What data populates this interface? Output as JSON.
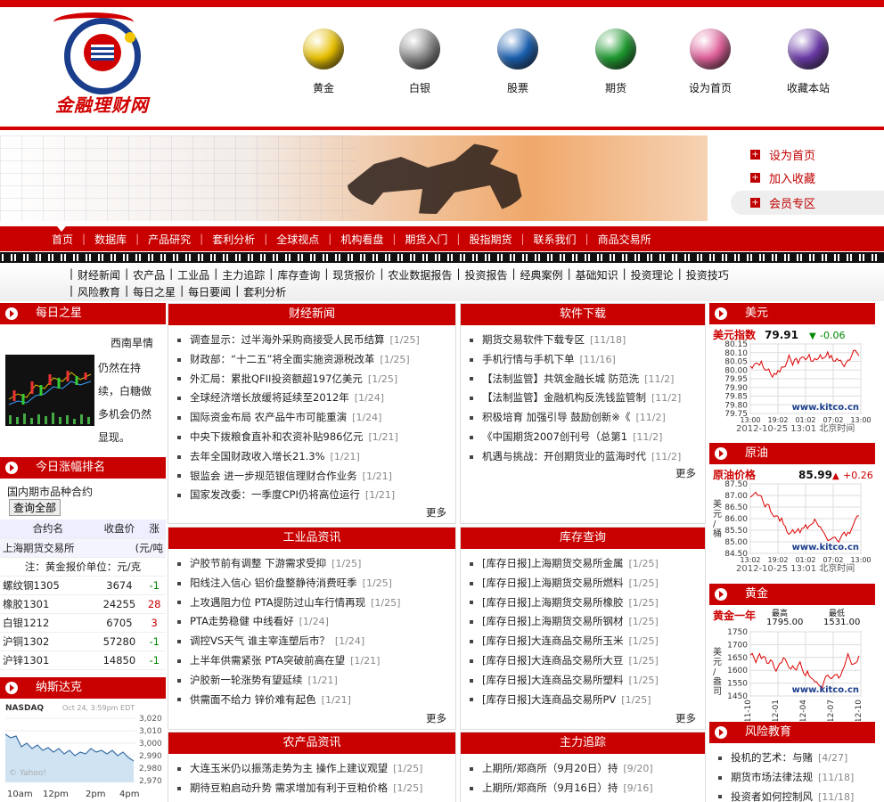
{
  "logo": {
    "text": "金融理财网"
  },
  "topnav": [
    {
      "label": "黄金",
      "color": "#e8c000",
      "icon": "gold-orb-icon"
    },
    {
      "label": "白银",
      "color": "#8a8a8a",
      "icon": "silver-orb-icon"
    },
    {
      "label": "股票",
      "color": "#1a5fb0",
      "icon": "stock-orb-icon"
    },
    {
      "label": "期货",
      "color": "#1e9a30",
      "icon": "futures-orb-icon"
    },
    {
      "label": "设为首页",
      "color": "#e0609a",
      "icon": "home-orb-icon"
    },
    {
      "label": "收藏本站",
      "color": "#6b3aa8",
      "icon": "bookmark-orb-icon"
    }
  ],
  "side_links": [
    "设为首页",
    "加入收藏",
    "会员专区"
  ],
  "mainnav": [
    "首页",
    "数据库",
    "产品研究",
    "套利分析",
    "全球视点",
    "机构看盘",
    "期货入门",
    "股指期货",
    "联系我们",
    "商品交易所"
  ],
  "subnav_row1": [
    "财经新闻",
    "农产品",
    "工业品",
    "主力追踪",
    "库存查询",
    "现货报价",
    "农业数据报告",
    "投资报告",
    "经典案例",
    "基础知识",
    "投资理论",
    "投资技巧"
  ],
  "subnav_row2": [
    "风险教育",
    "每日之星",
    "每日要闻",
    "套利分析"
  ],
  "left": {
    "star_title": "每日之星",
    "star_text": [
      "西南旱情",
      "仍然在持",
      "续，白糖做",
      "多机会仍然",
      "显现。"
    ],
    "rank_title": "今日涨幅排名",
    "rank_sub": "国内期市品种合约",
    "rank_btn": "查询全部",
    "rank_headers": [
      "合约名",
      "收盘价",
      "涨"
    ],
    "rank_exchange": "上海期货交易所",
    "rank_unit": "(元/吨",
    "rank_note": "注：黄金报价单位：元/克",
    "rank_rows": [
      {
        "name": "螺纹钢1305",
        "price": "3674",
        "chg": "-1",
        "dir": "dn"
      },
      {
        "name": "橡胶1301",
        "price": "24255",
        "chg": "28",
        "dir": "up"
      },
      {
        "name": "白银1212",
        "price": "6705",
        "chg": "3",
        "dir": "up"
      },
      {
        "name": "沪铜1302",
        "price": "57280",
        "chg": "-1",
        "dir": "dn"
      },
      {
        "name": "沪锌1301",
        "price": "14850",
        "chg": "-1",
        "dir": "dn"
      }
    ],
    "nasdaq_title": "纳斯达克",
    "nasdaq_label": "NASDAQ",
    "nasdaq_date": "Oct 24, 3:59pm EDT",
    "nasdaq_yticks": [
      "3,020",
      "3,010",
      "3,000",
      "2,990",
      "2,980",
      "2,970"
    ],
    "nasdaq_xticks": [
      "10am",
      "12pm",
      "2pm",
      "4pm"
    ],
    "nasdaq_watermark": "© Yahoo!"
  },
  "panels": {
    "caijing": {
      "title": "财经新闻",
      "more": "更多",
      "items": [
        {
          "t": "调查显示：过半海外采购商接受人民币结算",
          "d": "[1/25]"
        },
        {
          "t": "财政部：“十二五”将全面实施资源税改革",
          "d": "[1/25]"
        },
        {
          "t": "外汇局：累批QFII投资额超197亿美元",
          "d": "[1/25]"
        },
        {
          "t": "全球经济增长放缓将延续至2012年",
          "d": "[1/24]"
        },
        {
          "t": "国际资金布局  农产品牛市可能重演",
          "d": "[1/24]"
        },
        {
          "t": "中央下拨粮食直补和农资补贴986亿元",
          "d": "[1/21]"
        },
        {
          "t": "去年全国财政收入增长21.3%",
          "d": "[1/21]"
        },
        {
          "t": "银监会 进一步规范银信理财合作业务",
          "d": "[1/21]"
        },
        {
          "t": "国家发改委：一季度CPI仍将高位运行",
          "d": "[1/21]"
        }
      ]
    },
    "software": {
      "title": "软件下载",
      "more": "更多",
      "items": [
        {
          "t": "期货交易软件下载专区",
          "d": "[11/18]"
        },
        {
          "t": "手机行情与手机下单",
          "d": "[11/16]"
        },
        {
          "t": "【法制监管】共筑金融长城 防范洗",
          "d": "[11/2]"
        },
        {
          "t": "【法制监管】金融机构反洗钱监管制",
          "d": "[11/2]"
        },
        {
          "t": "积极培育 加强引导 鼓励创新※《",
          "d": "[11/2]"
        },
        {
          "t": "《中国期货2007创刊号（总第1",
          "d": "[11/2]"
        },
        {
          "t": "机遇与挑战：开创期货业的蓝海时代",
          "d": "[11/2]"
        }
      ]
    },
    "industry": {
      "title": "工业品资讯",
      "more": "更多",
      "items": [
        {
          "t": "沪胶节前有调整 下游需求受抑",
          "d": "[1/25]"
        },
        {
          "t": "阳线注入信心 铝价盘整静待消费旺季",
          "d": "[1/25]"
        },
        {
          "t": "上攻遇阻力位 PTA提防过山车行情再现",
          "d": "[1/25]"
        },
        {
          "t": "PTA走势稳健 中线看好",
          "d": "[1/24]"
        },
        {
          "t": "调控VS天气 谁主宰连塑后市？",
          "d": "[1/24]"
        },
        {
          "t": "上半年供需紧张 PTA突破前高在望",
          "d": "[1/21]"
        },
        {
          "t": "沪胶新一轮涨势有望延续",
          "d": "[1/21]"
        },
        {
          "t": "供需面不给力 锌价难有起色",
          "d": "[1/21]"
        }
      ]
    },
    "stock": {
      "title": "库存查询",
      "more": "更多",
      "items": [
        {
          "t": "[库存日报]上海期货交易所金属",
          "d": "[1/25]"
        },
        {
          "t": "[库存日报]上海期货交易所燃料",
          "d": "[1/25]"
        },
        {
          "t": "[库存日报]上海期货交易所橡胶",
          "d": "[1/25]"
        },
        {
          "t": "[库存日报]上海期货交易所钢材",
          "d": "[1/25]"
        },
        {
          "t": "[库存日报]大连商品交易所玉米",
          "d": "[1/25]"
        },
        {
          "t": "[库存日报]大连商品交易所大豆",
          "d": "[1/25]"
        },
        {
          "t": "[库存日报]大连商品交易所塑料",
          "d": "[1/25]"
        },
        {
          "t": "[库存日报]大连商品交易所PV",
          "d": "[1/25]"
        }
      ]
    },
    "agri": {
      "title": "农产品资讯",
      "items": [
        {
          "t": "大连玉米仍以振荡走势为主 操作上建议观望",
          "d": "[1/25]"
        },
        {
          "t": "期待豆粕启动升势 需求增加有利于豆粕价格",
          "d": "[1/25]"
        }
      ]
    },
    "main": {
      "title": "主力追踪",
      "items": [
        {
          "t": "上期所/郑商所（9月20日）持",
          "d": "[9/20]"
        },
        {
          "t": "上期所/郑商所（9月16日）持",
          "d": "[9/16]"
        }
      ]
    }
  },
  "right": {
    "usd": {
      "title": "美元",
      "label": "美元指数",
      "value": "79.91",
      "chg": "-0.06",
      "yticks": [
        "80.15",
        "80.10",
        "80.05",
        "80.00",
        "79.95",
        "79.90",
        "79.85",
        "79.80",
        "79.75"
      ],
      "xticks": [
        "13:00",
        "19:02",
        "01:02",
        "07:02",
        "13:00"
      ],
      "site": "www.kitco.cn",
      "time": "2012-10-25 13:01 北京时间"
    },
    "oil": {
      "title": "原油",
      "label": "原油价格",
      "value": "85.99",
      "chg": "+0.26",
      "unit": "美元/桶",
      "yticks": [
        "87.50",
        "87.00",
        "86.50",
        "86.00",
        "85.50",
        "85.00",
        "84.50"
      ],
      "xticks": [
        "13:02",
        "19:02",
        "01:02",
        "07:02",
        "13:00"
      ],
      "site": "www.kitco.cn",
      "time": "2012-10-25 13:01 北京时间"
    },
    "gold": {
      "title": "黄金",
      "label": "黄金一年",
      "high_label": "最高",
      "high": "1795.00",
      "low_label": "最低",
      "low": "1531.00",
      "unit": "美元/盎司",
      "yticks": [
        "1750",
        "1700",
        "1650",
        "1600",
        "1550",
        "1450"
      ],
      "xticks": [
        "11-10",
        "12-01",
        "12-04",
        "12-07",
        "12-10"
      ],
      "site": "www.kitco.cn"
    },
    "risk": {
      "title": "风险教育",
      "items": [
        {
          "t": "投机的艺术：与赌",
          "d": "[4/27]"
        },
        {
          "t": "期货市场法律法规",
          "d": "[11/18]"
        },
        {
          "t": "投资者如何控制风",
          "d": "[11/18]"
        }
      ]
    }
  },
  "colors": {
    "brand_red": "#c90000",
    "up": "#cc0000",
    "down": "#008800"
  }
}
